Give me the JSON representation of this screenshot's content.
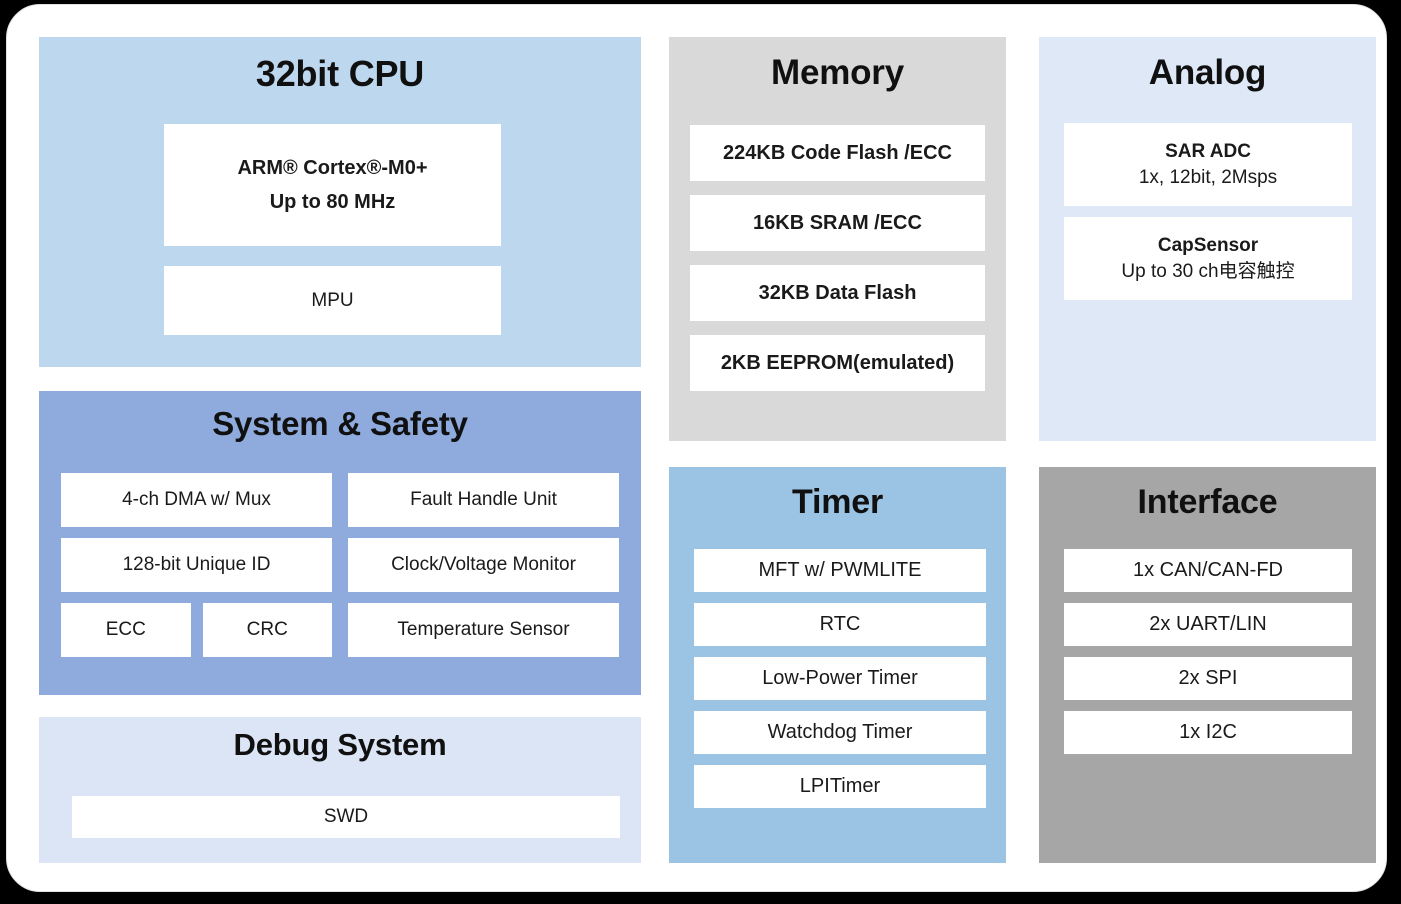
{
  "diagram": {
    "background_color": "#000000",
    "card_color": "#ffffff"
  },
  "blocks": {
    "cpu": {
      "title": "32bit CPU",
      "color": "#bdd7ee",
      "core": {
        "name": "ARM® Cortex®-M0+",
        "speed": "Up to 80 MHz"
      },
      "mpu": "MPU"
    },
    "safety": {
      "title": "System & Safety",
      "color": "#8faadc",
      "left_items": [
        "4-ch DMA w/ Mux",
        "128-bit Unique ID"
      ],
      "split_items": [
        "ECC",
        "CRC"
      ],
      "right_items": [
        "Fault Handle Unit",
        "Clock/Voltage Monitor",
        "Temperature Sensor"
      ]
    },
    "debug": {
      "title": "Debug System",
      "color": "#dce5f5",
      "items": [
        "SWD"
      ]
    },
    "memory": {
      "title": "Memory",
      "color": "#d9d9d9",
      "items": [
        "224KB Code Flash /ECC",
        "16KB SRAM /ECC",
        "32KB Data Flash",
        "2KB EEPROM(emulated)"
      ]
    },
    "timer": {
      "title": "Timer",
      "color": "#9bc4e4",
      "items": [
        "MFT w/ PWMLITE",
        "RTC",
        "Low-Power Timer",
        "Watchdog Timer",
        "LPITimer"
      ]
    },
    "analog": {
      "title": "Analog",
      "color": "#dee8f7",
      "items": [
        {
          "name": "SAR ADC",
          "detail": "1x, 12bit, 2Msps"
        },
        {
          "name": "CapSensor",
          "detail": "Up to 30 ch电容触控"
        }
      ]
    },
    "interface": {
      "title": "Interface",
      "color": "#a6a6a6",
      "items": [
        "1x CAN/CAN-FD",
        "2x UART/LIN",
        "2x SPI",
        "1x I2C"
      ]
    }
  }
}
